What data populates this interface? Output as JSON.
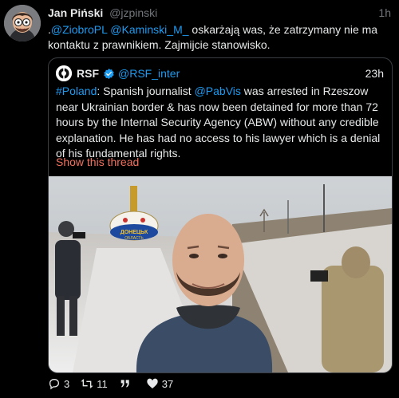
{
  "tweet": {
    "author_name": "Jan Piński",
    "author_handle": "@jzpinski",
    "time": "1h",
    "text_prefix": ".",
    "mention1": "@ZiobroPL",
    "mention2": "@Kaminski_M_",
    "text_body": " oskarżają was, że zatrzymany nie ma kontaktu z prawnikiem.  Zajmijcie stanowisko."
  },
  "quote": {
    "author_name": "RSF",
    "author_handle": "@RSF_inter",
    "time": "23h",
    "hashtag": "#Poland",
    "text_a": ": Spanish journalist ",
    "mention": "@PabVis",
    "text_b": " was arrested in Rzeszow near Ukrainian border & has now been detained for more than 72 hours by the Internal Security Agency (ABW) without any credible explanation. He has had no access to his lawyer which is a denial of his fundamental rights.",
    "show_thread": "Show this thread",
    "sign_top": "ДОНЕЦЬК",
    "sign_bottom": "ОБЛАСТЬ"
  },
  "actions": {
    "replies": "3",
    "retweets": "11",
    "likes": "37"
  },
  "colors": {
    "link": "#1d9bf0",
    "show_thread": "#f2705e",
    "muted": "#71767b"
  }
}
